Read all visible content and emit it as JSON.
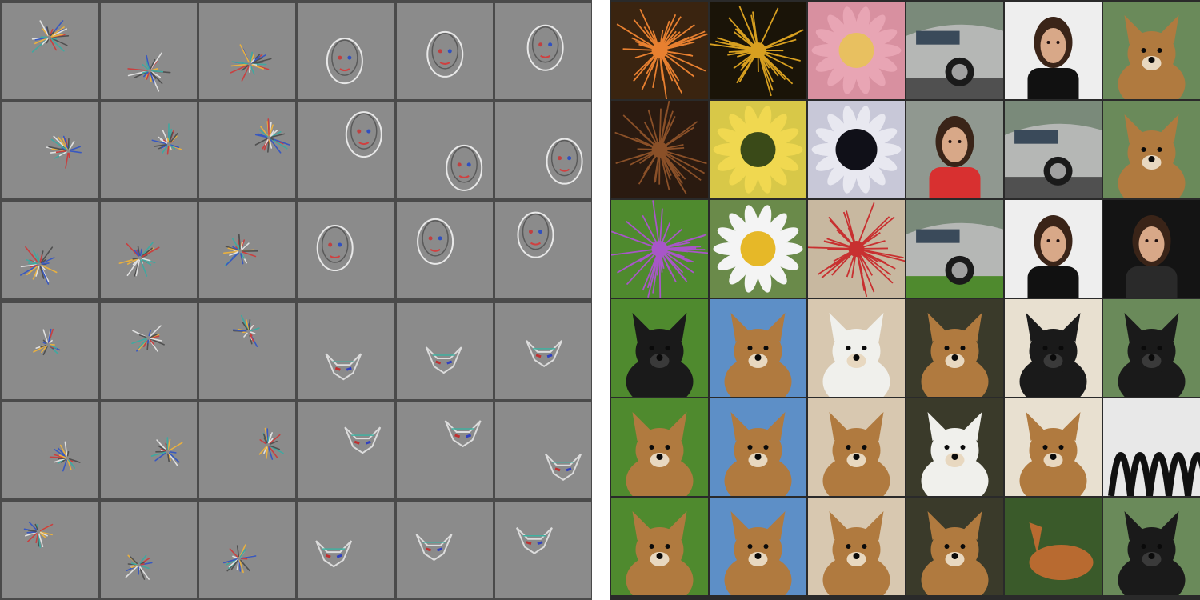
{
  "figure": {
    "left_panel": {
      "kind": "feature-visualization-grid",
      "quadrants": [
        {
          "pattern": "flower-texture"
        },
        {
          "pattern": "face-outline"
        },
        {
          "pattern": "fur-texture"
        },
        {
          "pattern": "pointed-ears"
        }
      ]
    },
    "right_panel": {
      "kind": "image-patch-grid",
      "rows": [
        [
          "orange-sea-urchin",
          "yellow-spiky-flower",
          "pink-gerbera",
          "silver-minivan",
          "woman-portrait",
          "small-terrier"
        ],
        [
          "brown-spiky-pod",
          "sunflower-center",
          "dark-daisy-center",
          "woman-red-shirt",
          "silver-sports-car",
          "cocker-spaniel"
        ],
        [
          "purple-thistle",
          "white-daisy",
          "red-spiky-flower",
          "silver-convertible",
          "woman-portrait",
          "woman-smiling"
        ],
        [
          "chihuahua",
          "collie",
          "small-white-dog",
          "dingo",
          "black-shepherd",
          "black-shepherd"
        ],
        [
          "german-shepherd",
          "collie",
          "cairn-terrier",
          "white-wolf",
          "dingo",
          "iron-bench"
        ],
        [
          "yorkshire-terrier",
          "papillon",
          "terrier",
          "spitz",
          "deer",
          "hairless-dog"
        ]
      ],
      "colors": {
        "grass": "#4f8a2e",
        "sky": "#5d8fc7",
        "fur": "#b07a3f",
        "black_fur": "#1a1a1a",
        "car": "#b5b7b5",
        "petal_pink": "#e8a5b4",
        "sunflower": "#e6b828",
        "thistle": "#a856c8"
      }
    }
  }
}
